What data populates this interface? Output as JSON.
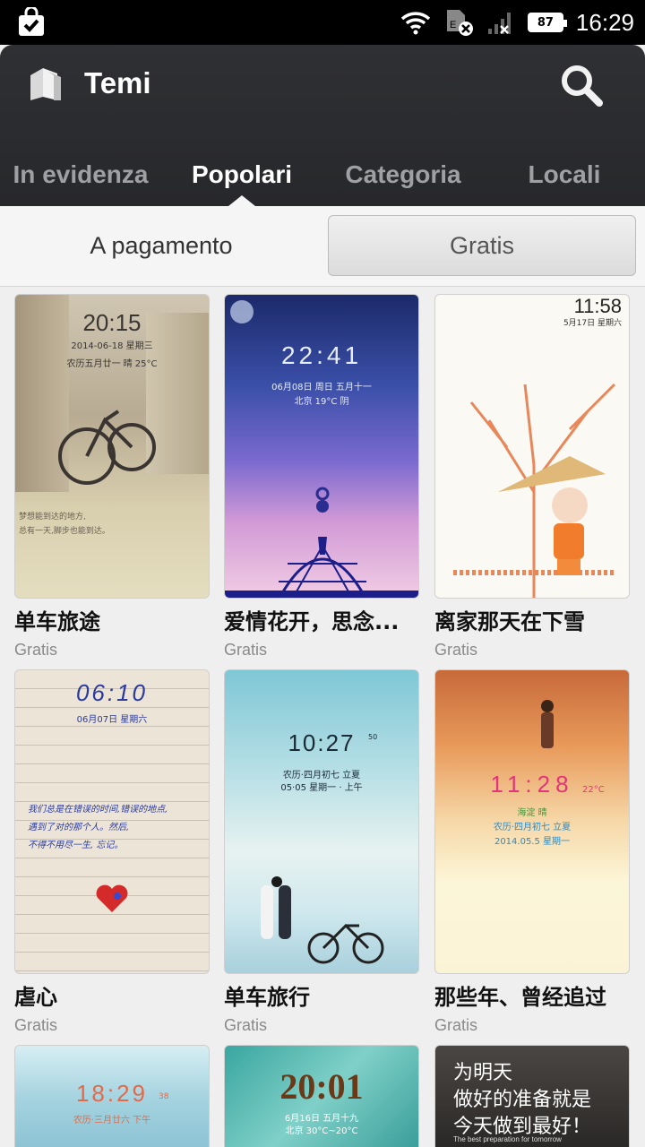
{
  "status_bar": {
    "battery": "87",
    "time": "16:29"
  },
  "header": {
    "title": "Temi"
  },
  "tabs": [
    {
      "label": "In evidenza"
    },
    {
      "label": "Popolari"
    },
    {
      "label": "Categoria"
    },
    {
      "label": "Locali"
    }
  ],
  "segment": {
    "left_label": "A pagamento",
    "right_label": "Gratis"
  },
  "themes": [
    {
      "name": "单车旅途",
      "price": "Gratis",
      "clock": "20:15",
      "date": "2014-06-18 星期三",
      "lunar": "农历五月廿一  晴 25°C",
      "caption_1": "梦想能到达的地方,",
      "caption_2": "总有一天,脚步也能到达。"
    },
    {
      "name": "爱情花开，思念...",
      "price": "Gratis",
      "clock": "22:41",
      "date": "06月08日 周日 五月十一",
      "lunar": "北京 19°C 阴"
    },
    {
      "name": "离家那天在下雪",
      "price": "Gratis",
      "clock": "11:58",
      "date": "5月17日 星期六"
    },
    {
      "name": "虐心",
      "price": "Gratis",
      "clock": "06:10",
      "date": "06月07日 星期六",
      "caption_1": "我们总是在错误的时间,错误的地点,",
      "caption_2": "遇到了对的那个人。然后,",
      "caption_3": "不得不用尽一生,  忘记。"
    },
    {
      "name": "单车旅行",
      "price": "Gratis",
      "clock": "10:27",
      "seconds": "50",
      "date": "农历·四月初七 立夏",
      "lunar": "05·05 星期一 · 上午"
    },
    {
      "name": "那些年、曾经追过",
      "price": "Gratis",
      "clock": "11:28",
      "temp": "22°C",
      "weather": "海淀    晴",
      "date": "农历·四月初七 立夏",
      "lunar": "2014.05.5 星期一"
    },
    {
      "clock": "18:29",
      "seconds": "38",
      "date": "农历·三月廿六 下午"
    },
    {
      "clock": "20:01",
      "date": "6月16日 五月十九",
      "lunar": "北京 30°C~20°C"
    },
    {
      "line_1": "为明天",
      "line_2": "做好的准备就是",
      "line_3": "今天做到最好！",
      "line_4": "The best preparation for tomorrow"
    }
  ],
  "colors": {
    "header_bg": "#2f3033",
    "tab_inactive": "#9ea0a4",
    "price": "#8a8a8a"
  }
}
